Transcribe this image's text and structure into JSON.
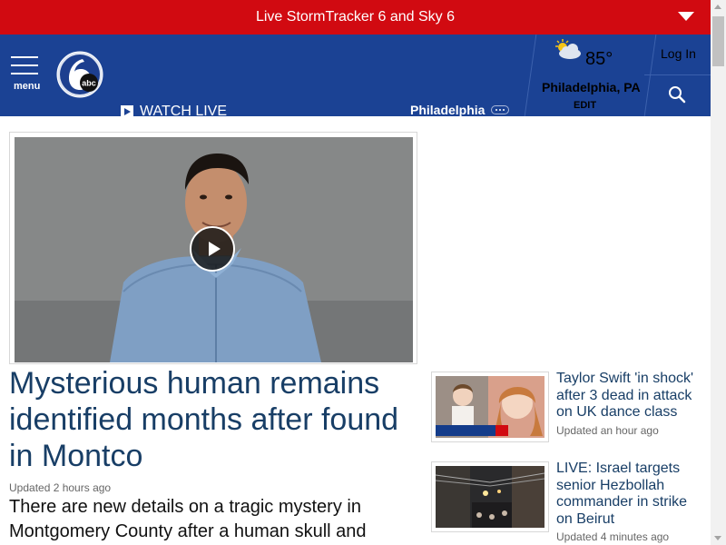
{
  "alert_bar": {
    "text": "Live StormTracker 6 and Sky 6"
  },
  "header": {
    "menu_label": "menu",
    "logo_text": "abc",
    "watch_live": "WATCH LIVE",
    "city": "Philadelphia",
    "weather": {
      "temperature": "85°",
      "city": "Philadelphia, PA",
      "edit": "EDIT",
      "icon": "partly-sunny-icon"
    },
    "login": "Log In",
    "search_icon": "search-icon"
  },
  "hero": {
    "video_play_icon": "play-icon",
    "headline": "Mysterious human remains identified months after found in Montco",
    "timestamp": "Updated 2 hours ago",
    "summary": "There are new details on a tragic mystery in Montgomery County after a human skull and"
  },
  "side_stories": [
    {
      "title": "Taylor Swift 'in shock' after 3 dead in attack on UK dance class",
      "time": "Updated an hour ago"
    },
    {
      "title": "LIVE: Israel targets senior Hezbollah commander in strike on Beirut",
      "time": "Updated 4 minutes ago"
    }
  ],
  "colors": {
    "alert_red": "#d10a11",
    "header_navy": "#1b4294",
    "headline_blue": "#183e66"
  }
}
